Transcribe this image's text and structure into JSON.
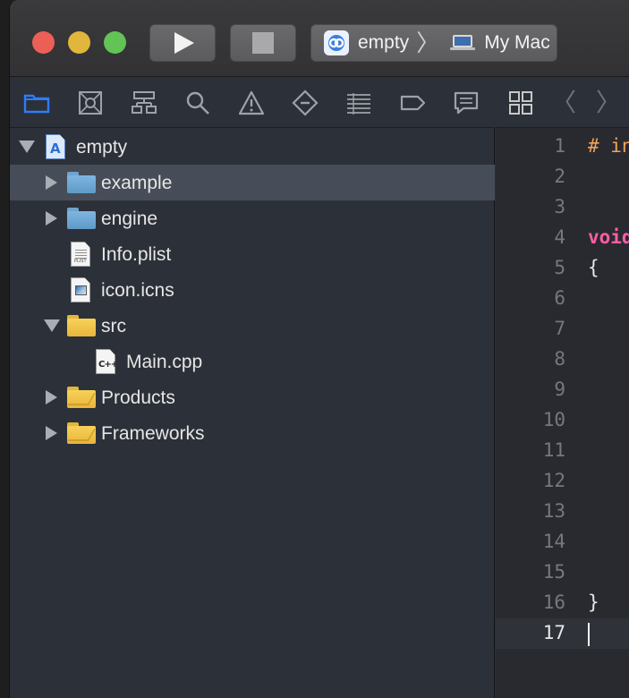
{
  "toolbar": {
    "traffic_lights": [
      "close",
      "minimize",
      "zoom"
    ],
    "run_icon": "play-icon",
    "stop_icon": "stop-icon",
    "scheme": {
      "project": "empty",
      "separator": "〉",
      "destination": "My Mac"
    }
  },
  "navigator": {
    "tabs": [
      {
        "name": "project-navigator",
        "icon": "folder-icon",
        "active": true
      },
      {
        "name": "source-control-navigator",
        "icon": "source-control-icon"
      },
      {
        "name": "symbol-navigator",
        "icon": "hierarchy-icon"
      },
      {
        "name": "find-navigator",
        "icon": "search-icon"
      },
      {
        "name": "issue-navigator",
        "icon": "warning-icon"
      },
      {
        "name": "test-navigator",
        "icon": "diamond-icon"
      },
      {
        "name": "debug-navigator",
        "icon": "list-icon"
      },
      {
        "name": "breakpoint-navigator",
        "icon": "tag-icon"
      },
      {
        "name": "report-navigator",
        "icon": "chat-icon"
      }
    ],
    "items": [
      {
        "label": "empty",
        "kind": "project",
        "expanded": true
      },
      {
        "label": "example",
        "kind": "folder-blue",
        "expanded": false,
        "selected": true
      },
      {
        "label": "engine",
        "kind": "folder-blue",
        "expanded": false
      },
      {
        "label": "Info.plist",
        "kind": "plist"
      },
      {
        "label": "icon.icns",
        "kind": "icns"
      },
      {
        "label": "src",
        "kind": "group",
        "expanded": true
      },
      {
        "label": "Main.cpp",
        "kind": "cpp"
      },
      {
        "label": "Products",
        "kind": "group",
        "expanded": false
      },
      {
        "label": "Frameworks",
        "kind": "group",
        "expanded": false
      }
    ],
    "plist_tag": "PLIST",
    "cpp_tag": "C++"
  },
  "editor": {
    "lines": [
      {
        "n": "1",
        "text": "# in",
        "style": "preproc"
      },
      {
        "n": "2",
        "text": ""
      },
      {
        "n": "3",
        "text": ""
      },
      {
        "n": "4",
        "text": "void",
        "style": "keyword"
      },
      {
        "n": "5",
        "text": "{"
      },
      {
        "n": "6",
        "text": ""
      },
      {
        "n": "7",
        "text": ""
      },
      {
        "n": "8",
        "text": ""
      },
      {
        "n": "9",
        "text": ""
      },
      {
        "n": "10",
        "text": ""
      },
      {
        "n": "11",
        "text": ""
      },
      {
        "n": "12",
        "text": ""
      },
      {
        "n": "13",
        "text": ""
      },
      {
        "n": "14",
        "text": ""
      },
      {
        "n": "15",
        "text": ""
      },
      {
        "n": "16",
        "text": "}"
      },
      {
        "n": "17",
        "text": "",
        "current": true
      }
    ],
    "back_glyph": "〈",
    "forward_glyph": "〉"
  },
  "colors": {
    "accent": "#2f7cf6",
    "keyword": "#fc5fa3",
    "preprocessor": "#f3a258"
  }
}
